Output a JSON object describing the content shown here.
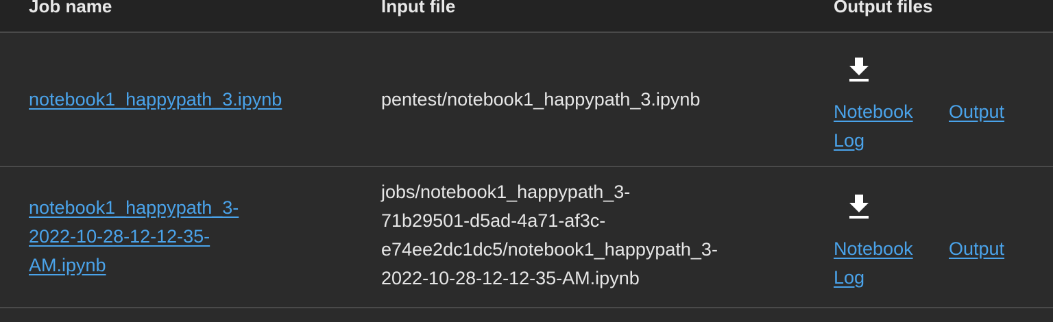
{
  "header": {
    "job_name": "Job name",
    "input_file": "Input file",
    "output_files": "Output files"
  },
  "rows": [
    {
      "job_name": "notebook1_happypath_3.ipynb",
      "input_file": "pentest/notebook1_happypath_3.ipynb",
      "download_icon": "download-icon",
      "notebook_link": "Notebook\nLog",
      "output_link": "Output"
    },
    {
      "job_name": "notebook1_happypath_3-\n2022-10-28-12-12-35-\nAM.ipynb",
      "input_file": "jobs/notebook1_happypath_3-\n71b29501-d5ad-4a71-af3c-\ne74ee2dc1dc5/notebook1_happypath_3-\n2022-10-28-12-12-35-AM.ipynb",
      "download_icon": "download-icon",
      "notebook_link": "Notebook\nLog",
      "output_link": "Output"
    }
  ],
  "colors": {
    "background": "#2b2b2b",
    "header_background": "#232323",
    "link": "#4aa3ea",
    "divider": "#4a4a4a"
  }
}
